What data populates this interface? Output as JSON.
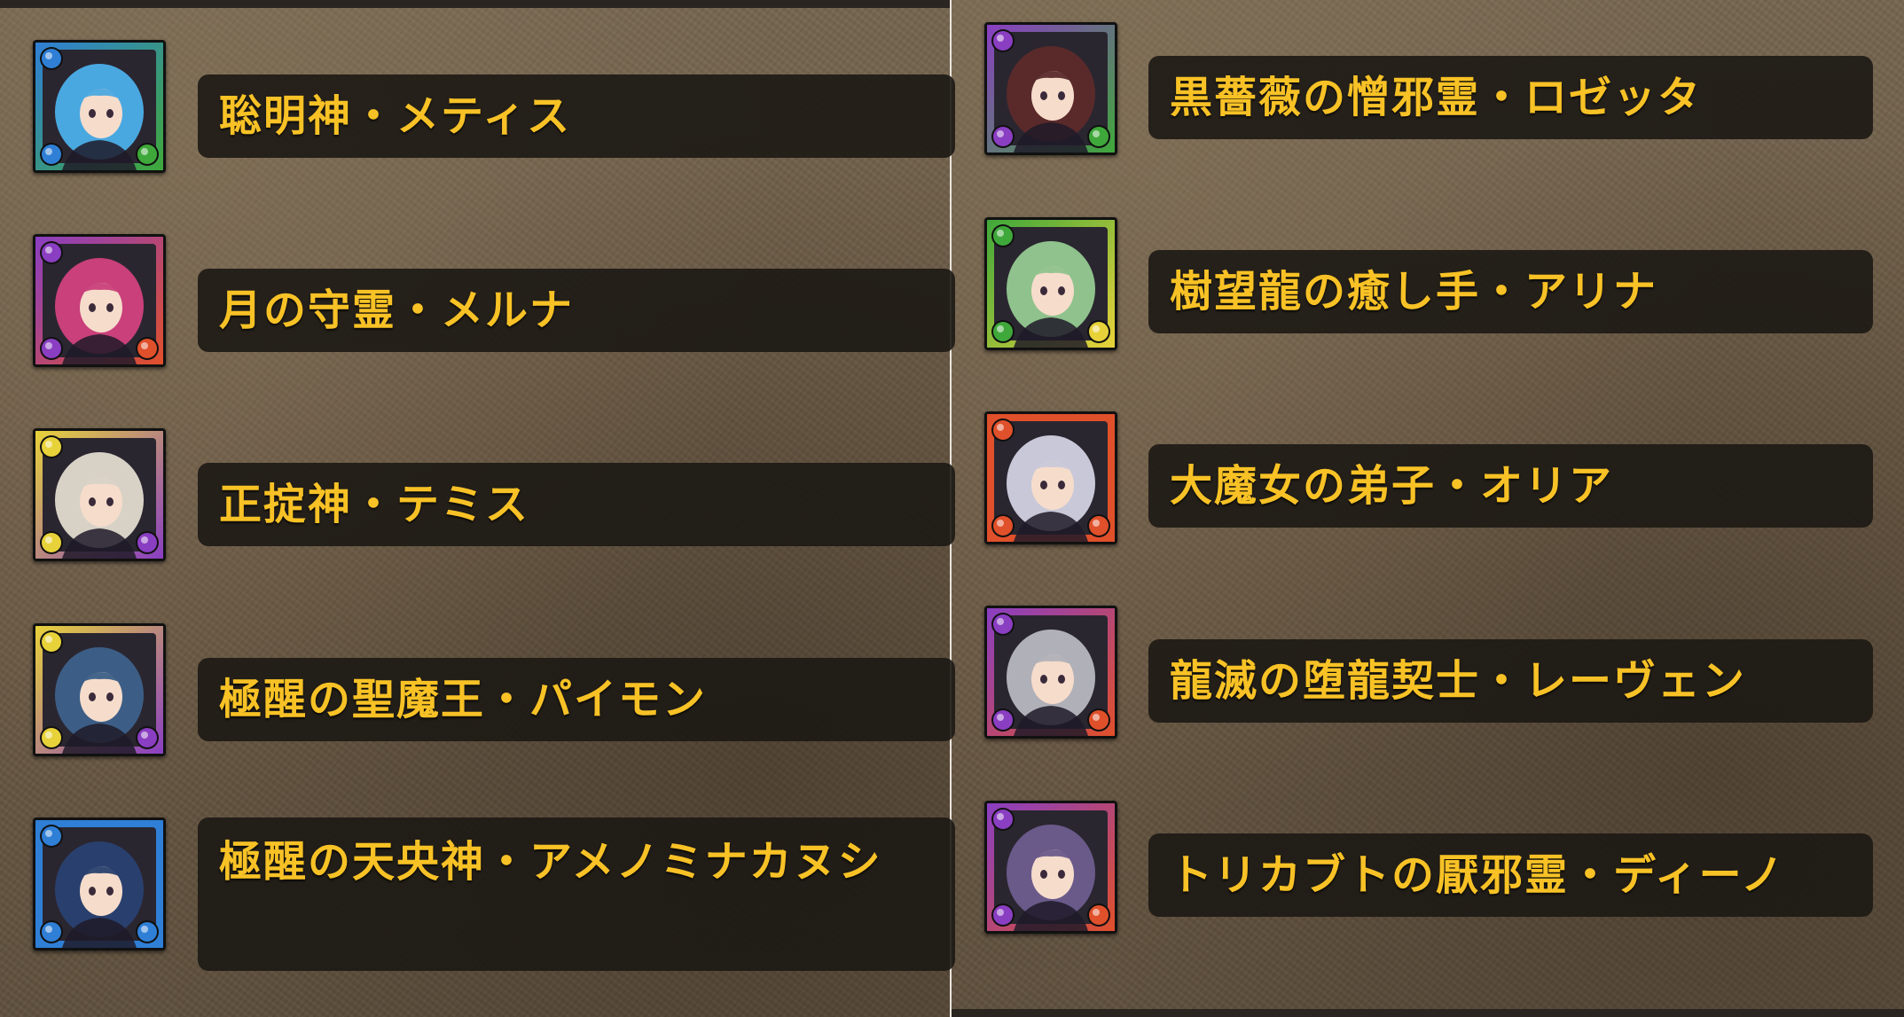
{
  "monsters_left": [
    {
      "name": "聡明神・メティス",
      "attr_main": "water",
      "attr_sub": "wood",
      "icon_color": "#4aa8e0"
    },
    {
      "name": "月の守霊・メルナ",
      "attr_main": "dark",
      "attr_sub": "fire",
      "icon_color": "#c9407a"
    },
    {
      "name": "正掟神・テミス",
      "attr_main": "light",
      "attr_sub": "dark",
      "icon_color": "#d8d2c6"
    },
    {
      "name": "極醒の聖魔王・パイモン",
      "attr_main": "light",
      "attr_sub": "dark",
      "icon_color": "#3c5e86"
    },
    {
      "name": "極醒の天央神・アメノミナカヌシ",
      "attr_main": "water",
      "attr_sub": "water",
      "icon_color": "#29406e"
    }
  ],
  "monsters_right": [
    {
      "name": "黒薔薇の憎邪霊・ロゼッタ",
      "attr_main": "dark",
      "attr_sub": "wood",
      "icon_color": "#5a2a2a"
    },
    {
      "name": "樹望龍の癒し手・アリナ",
      "attr_main": "wood",
      "attr_sub": "light",
      "icon_color": "#8fc28c"
    },
    {
      "name": "大魔女の弟子・オリア",
      "attr_main": "fire",
      "attr_sub": "fire",
      "icon_color": "#c8c8d8"
    },
    {
      "name": "龍滅の堕龍契士・レーヴェン",
      "attr_main": "dark",
      "attr_sub": "fire",
      "icon_color": "#b0b0b8"
    },
    {
      "name": "トリカブトの厭邪霊・ディーノ",
      "attr_main": "dark",
      "attr_sub": "fire",
      "icon_color": "#6a5a8a"
    }
  ],
  "attribute_colors": {
    "water": "#2f7fd6",
    "wood": "#3fa83a",
    "fire": "#e0502a",
    "light": "#e8d23a",
    "dark": "#8a3ec2"
  }
}
